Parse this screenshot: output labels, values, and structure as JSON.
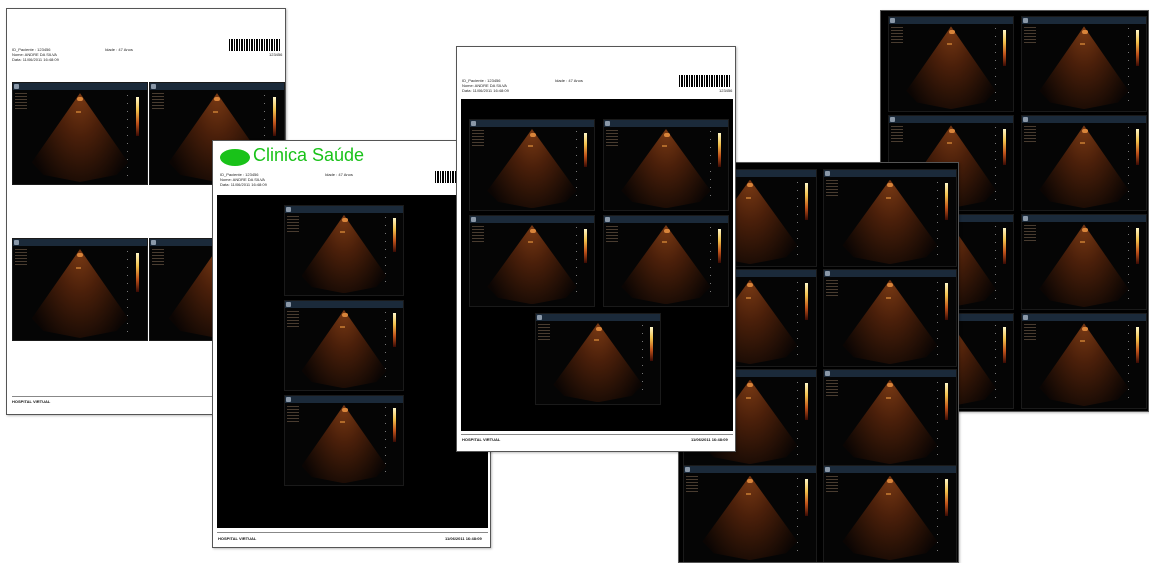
{
  "header": {
    "id_label": "ID_Paciente :",
    "id_value": "123456",
    "name_label": "Nome:",
    "name_value": "ANDRE DA SILVA",
    "date_label": "Data:",
    "date_value": "11/06/2011 16:48:09",
    "age_label": "Idade :",
    "age_value": "47 Anos",
    "barcode_number": "123456"
  },
  "clinic": {
    "name": "Clinica Saúde",
    "logo_color": "#19c219"
  },
  "footer": {
    "left": "HOSPITAL VIRTUAL",
    "right": "11/06/2011 16:48:09"
  },
  "colors": {
    "sheet_border": "#555555",
    "image_area": "#000000"
  }
}
